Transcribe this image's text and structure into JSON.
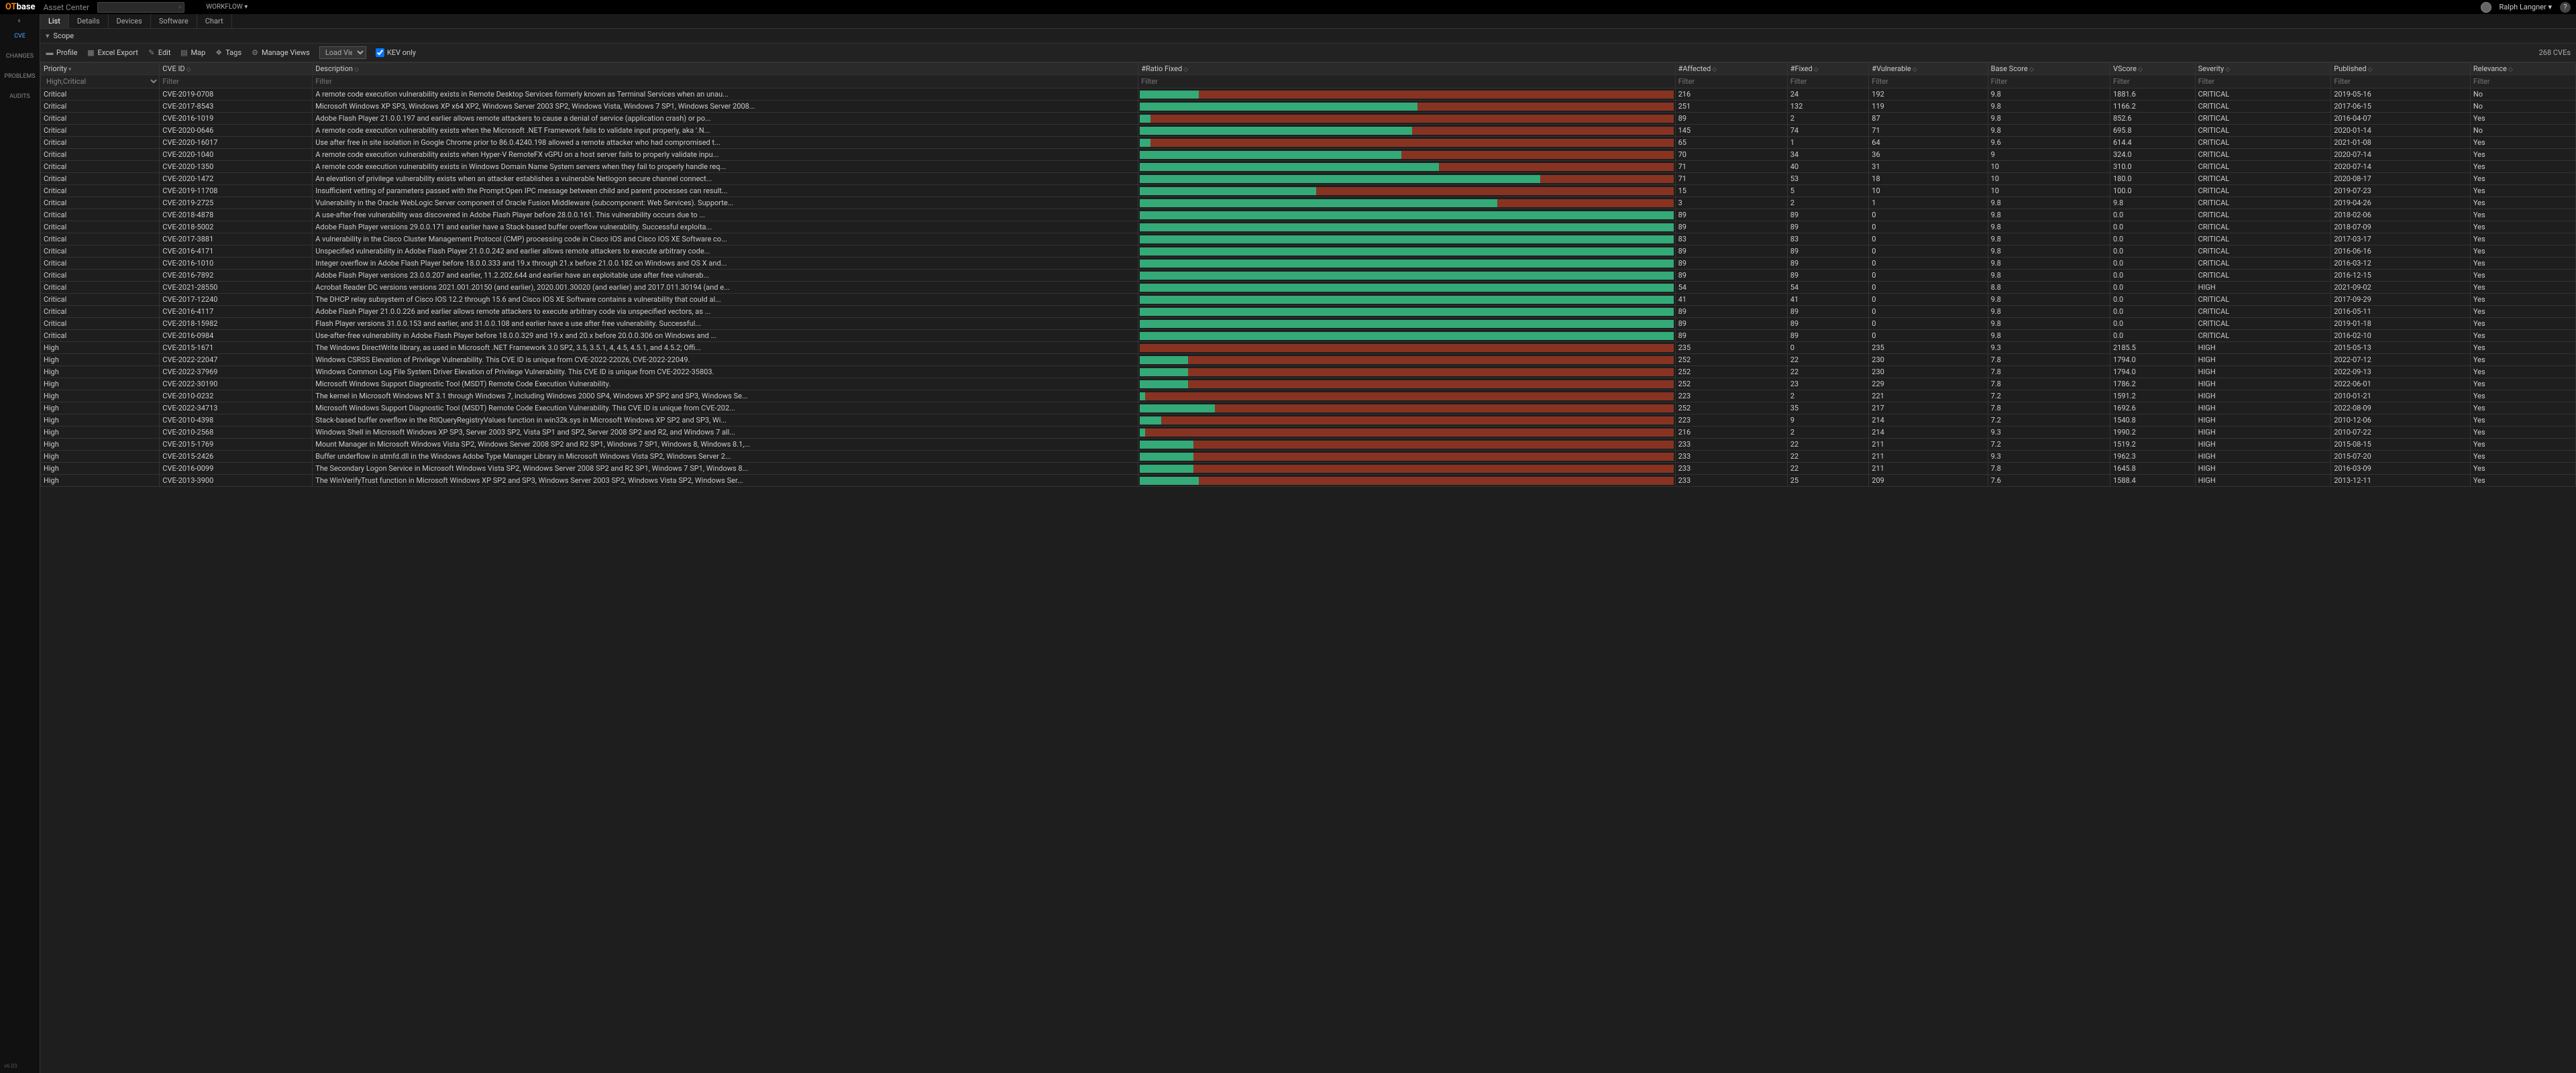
{
  "topbar": {
    "brand_ot": "OT",
    "brand_base": "base",
    "brand_sub": "Asset Center",
    "workflow": "WORKFLOW ▾",
    "username": "Ralph Langner ▾",
    "help": "?"
  },
  "leftnav": {
    "items": [
      "CVE",
      "CHANGES",
      "PROBLEMS",
      "AUDITS"
    ],
    "version": "v6.03"
  },
  "tabs": [
    "List",
    "Details",
    "Devices",
    "Software",
    "Chart"
  ],
  "scope_label": "Scope",
  "toolbar": {
    "profile": "Profile",
    "excel": "Excel Export",
    "edit": "Edit",
    "map": "Map",
    "tags": "Tags",
    "manage": "Manage Views",
    "load_view": "Load View ...",
    "kev": "KEV only",
    "count": "268 CVEs"
  },
  "columns": [
    "Priority",
    "CVE ID",
    "Description",
    "#Ratio Fixed",
    "#Affected",
    "#Fixed",
    "#Vulnerable",
    "Base Score",
    "VScore",
    "Severity",
    "Published",
    "Relevance"
  ],
  "filters": {
    "priority": "High,Critical",
    "placeholder": "Filter"
  },
  "rows": [
    {
      "pri": "Critical",
      "cve": "CVE-2019-0708",
      "desc": "A remote code execution vulnerability exists in Remote Desktop Services formerly known as Terminal Services when an unau...",
      "ratio": 11,
      "aff": "216",
      "fix": "24",
      "vul": "192",
      "base": "9.8",
      "vsc": "1881.6",
      "sev": "CRITICAL",
      "pub": "2019-05-16",
      "rel": "No"
    },
    {
      "pri": "Critical",
      "cve": "CVE-2017-8543",
      "desc": "Microsoft Windows XP SP3, Windows XP x64 XP2, Windows Server 2003 SP2, Windows Vista, Windows 7 SP1, Windows Server 2008...",
      "ratio": 52,
      "aff": "251",
      "fix": "132",
      "vul": "119",
      "base": "9.8",
      "vsc": "1166.2",
      "sev": "CRITICAL",
      "pub": "2017-06-15",
      "rel": "No"
    },
    {
      "pri": "Critical",
      "cve": "CVE-2016-1019",
      "desc": "Adobe Flash Player 21.0.0.197 and earlier allows remote attackers to cause a denial of service (application crash) or po...",
      "ratio": 2,
      "aff": "89",
      "fix": "2",
      "vul": "87",
      "base": "9.8",
      "vsc": "852.6",
      "sev": "CRITICAL",
      "pub": "2016-04-07",
      "rel": "Yes"
    },
    {
      "pri": "Critical",
      "cve": "CVE-2020-0646",
      "desc": "A remote code execution vulnerability exists when the Microsoft .NET Framework fails to validate input properly, aka '.N...",
      "ratio": 51,
      "aff": "145",
      "fix": "74",
      "vul": "71",
      "base": "9.8",
      "vsc": "695.8",
      "sev": "CRITICAL",
      "pub": "2020-01-14",
      "rel": "No"
    },
    {
      "pri": "Critical",
      "cve": "CVE-2020-16017",
      "desc": "Use after free in site isolation in Google Chrome prior to 86.0.4240.198 allowed a remote attacker who had compromised t...",
      "ratio": 2,
      "aff": "65",
      "fix": "1",
      "vul": "64",
      "base": "9.6",
      "vsc": "614.4",
      "sev": "CRITICAL",
      "pub": "2021-01-08",
      "rel": "Yes"
    },
    {
      "pri": "Critical",
      "cve": "CVE-2020-1040",
      "desc": "A remote code execution vulnerability exists when Hyper-V RemoteFX vGPU on a host server fails to properly validate inpu...",
      "ratio": 49,
      "aff": "70",
      "fix": "34",
      "vul": "36",
      "base": "9",
      "vsc": "324.0",
      "sev": "CRITICAL",
      "pub": "2020-07-14",
      "rel": "Yes"
    },
    {
      "pri": "Critical",
      "cve": "CVE-2020-1350",
      "desc": "A remote code execution vulnerability exists in Windows Domain Name System servers when they fail to properly handle req...",
      "ratio": 56,
      "aff": "71",
      "fix": "40",
      "vul": "31",
      "base": "10",
      "vsc": "310.0",
      "sev": "CRITICAL",
      "pub": "2020-07-14",
      "rel": "Yes"
    },
    {
      "pri": "Critical",
      "cve": "CVE-2020-1472",
      "desc": "An elevation of privilege vulnerability exists when an attacker establishes a vulnerable Netlogon secure channel connect...",
      "ratio": 75,
      "aff": "71",
      "fix": "53",
      "vul": "18",
      "base": "10",
      "vsc": "180.0",
      "sev": "CRITICAL",
      "pub": "2020-08-17",
      "rel": "Yes"
    },
    {
      "pri": "Critical",
      "cve": "CVE-2019-11708",
      "desc": "Insufficient vetting of parameters passed with the Prompt:Open IPC message between child and parent processes can result...",
      "ratio": 33,
      "aff": "15",
      "fix": "5",
      "vul": "10",
      "base": "10",
      "vsc": "100.0",
      "sev": "CRITICAL",
      "pub": "2019-07-23",
      "rel": "Yes"
    },
    {
      "pri": "Critical",
      "cve": "CVE-2019-2725",
      "desc": "Vulnerability in the Oracle WebLogic Server component of Oracle Fusion Middleware (subcomponent: Web Services). Supporte...",
      "ratio": 67,
      "aff": "3",
      "fix": "2",
      "vul": "1",
      "base": "9.8",
      "vsc": "9.8",
      "sev": "CRITICAL",
      "pub": "2019-04-26",
      "rel": "Yes"
    },
    {
      "pri": "Critical",
      "cve": "CVE-2018-4878",
      "desc": "A use-after-free vulnerability was discovered in Adobe Flash Player before 28.0.0.161. This vulnerability occurs due to ...",
      "ratio": 100,
      "aff": "89",
      "fix": "89",
      "vul": "0",
      "base": "9.8",
      "vsc": "0.0",
      "sev": "CRITICAL",
      "pub": "2018-02-06",
      "rel": "Yes"
    },
    {
      "pri": "Critical",
      "cve": "CVE-2018-5002",
      "desc": "Adobe Flash Player versions 29.0.0.171 and earlier have a Stack-based buffer overflow vulnerability. Successful exploita...",
      "ratio": 100,
      "aff": "89",
      "fix": "89",
      "vul": "0",
      "base": "9.8",
      "vsc": "0.0",
      "sev": "CRITICAL",
      "pub": "2018-07-09",
      "rel": "Yes"
    },
    {
      "pri": "Critical",
      "cve": "CVE-2017-3881",
      "desc": "A vulnerability in the Cisco Cluster Management Protocol (CMP) processing code in Cisco IOS and Cisco IOS XE Software co...",
      "ratio": 100,
      "aff": "83",
      "fix": "83",
      "vul": "0",
      "base": "9.8",
      "vsc": "0.0",
      "sev": "CRITICAL",
      "pub": "2017-03-17",
      "rel": "Yes"
    },
    {
      "pri": "Critical",
      "cve": "CVE-2016-4171",
      "desc": "Unspecified vulnerability in Adobe Flash Player 21.0.0.242 and earlier allows remote attackers to execute arbitrary code...",
      "ratio": 100,
      "aff": "89",
      "fix": "89",
      "vul": "0",
      "base": "9.8",
      "vsc": "0.0",
      "sev": "CRITICAL",
      "pub": "2016-06-16",
      "rel": "Yes"
    },
    {
      "pri": "Critical",
      "cve": "CVE-2016-1010",
      "desc": "Integer overflow in Adobe Flash Player before 18.0.0.333 and 19.x through 21.x before 21.0.0.182 on Windows and OS X and...",
      "ratio": 100,
      "aff": "89",
      "fix": "89",
      "vul": "0",
      "base": "9.8",
      "vsc": "0.0",
      "sev": "CRITICAL",
      "pub": "2016-03-12",
      "rel": "Yes"
    },
    {
      "pri": "Critical",
      "cve": "CVE-2016-7892",
      "desc": "Adobe Flash Player versions 23.0.0.207 and earlier, 11.2.202.644 and earlier have an exploitable use after free vulnerab...",
      "ratio": 100,
      "aff": "89",
      "fix": "89",
      "vul": "0",
      "base": "9.8",
      "vsc": "0.0",
      "sev": "CRITICAL",
      "pub": "2016-12-15",
      "rel": "Yes"
    },
    {
      "pri": "Critical",
      "cve": "CVE-2021-28550",
      "desc": "Acrobat Reader DC versions versions 2021.001.20150 (and earlier), 2020.001.30020 (and earlier) and 2017.011.30194 (and e...",
      "ratio": 100,
      "aff": "54",
      "fix": "54",
      "vul": "0",
      "base": "8.8",
      "vsc": "0.0",
      "sev": "HIGH",
      "pub": "2021-09-02",
      "rel": "Yes"
    },
    {
      "pri": "Critical",
      "cve": "CVE-2017-12240",
      "desc": "The DHCP relay subsystem of Cisco IOS 12.2 through 15.6 and Cisco IOS XE Software contains a vulnerability that could al...",
      "ratio": 100,
      "aff": "41",
      "fix": "41",
      "vul": "0",
      "base": "9.8",
      "vsc": "0.0",
      "sev": "CRITICAL",
      "pub": "2017-09-29",
      "rel": "Yes"
    },
    {
      "pri": "Critical",
      "cve": "CVE-2016-4117",
      "desc": "Adobe Flash Player 21.0.0.226 and earlier allows remote attackers to execute arbitrary code via unspecified vectors, as ...",
      "ratio": 100,
      "aff": "89",
      "fix": "89",
      "vul": "0",
      "base": "9.8",
      "vsc": "0.0",
      "sev": "CRITICAL",
      "pub": "2016-05-11",
      "rel": "Yes"
    },
    {
      "pri": "Critical",
      "cve": "CVE-2018-15982",
      "desc": "Flash Player versions 31.0.0.153 and earlier, and 31.0.0.108 and earlier have a use after free vulnerability. Successful...",
      "ratio": 100,
      "aff": "89",
      "fix": "89",
      "vul": "0",
      "base": "9.8",
      "vsc": "0.0",
      "sev": "CRITICAL",
      "pub": "2019-01-18",
      "rel": "Yes"
    },
    {
      "pri": "Critical",
      "cve": "CVE-2016-0984",
      "desc": "Use-after-free vulnerability in Adobe Flash Player before 18.0.0.329 and 19.x and 20.x before 20.0.0.306 on Windows and ...",
      "ratio": 100,
      "aff": "89",
      "fix": "89",
      "vul": "0",
      "base": "9.8",
      "vsc": "0.0",
      "sev": "CRITICAL",
      "pub": "2016-02-10",
      "rel": "Yes"
    },
    {
      "pri": "High",
      "cve": "CVE-2015-1671",
      "desc": "The Windows DirectWrite library, as used in Microsoft .NET Framework 3.0 SP2, 3.5, 3.5.1, 4, 4.5, 4.5.1, and 4.5.2; Offi...",
      "ratio": 0,
      "aff": "235",
      "fix": "0",
      "vul": "235",
      "base": "9.3",
      "vsc": "2185.5",
      "sev": "HIGH",
      "pub": "2015-05-13",
      "rel": "Yes"
    },
    {
      "pri": "High",
      "cve": "CVE-2022-22047",
      "desc": "Windows CSRSS Elevation of Privilege Vulnerability. This CVE ID is unique from CVE-2022-22026, CVE-2022-22049.",
      "ratio": 9,
      "aff": "252",
      "fix": "22",
      "vul": "230",
      "base": "7.8",
      "vsc": "1794.0",
      "sev": "HIGH",
      "pub": "2022-07-12",
      "rel": "Yes"
    },
    {
      "pri": "High",
      "cve": "CVE-2022-37969",
      "desc": "Windows Common Log File System Driver Elevation of Privilege Vulnerability. This CVE ID is unique from CVE-2022-35803.",
      "ratio": 9,
      "aff": "252",
      "fix": "22",
      "vul": "230",
      "base": "7.8",
      "vsc": "1794.0",
      "sev": "HIGH",
      "pub": "2022-09-13",
      "rel": "Yes"
    },
    {
      "pri": "High",
      "cve": "CVE-2022-30190",
      "desc": "Microsoft Windows Support Diagnostic Tool (MSDT) Remote Code Execution Vulnerability.",
      "ratio": 9,
      "aff": "252",
      "fix": "23",
      "vul": "229",
      "base": "7.8",
      "vsc": "1786.2",
      "sev": "HIGH",
      "pub": "2022-06-01",
      "rel": "Yes"
    },
    {
      "pri": "High",
      "cve": "CVE-2010-0232",
      "desc": "The kernel in Microsoft Windows NT 3.1 through Windows 7, including Windows 2000 SP4, Windows XP SP2 and SP3, Windows Se...",
      "ratio": 1,
      "aff": "223",
      "fix": "2",
      "vul": "221",
      "base": "7.2",
      "vsc": "1591.2",
      "sev": "HIGH",
      "pub": "2010-01-21",
      "rel": "Yes"
    },
    {
      "pri": "High",
      "cve": "CVE-2022-34713",
      "desc": "Microsoft Windows Support Diagnostic Tool (MSDT) Remote Code Execution Vulnerability. This CVE ID is unique from CVE-202...",
      "ratio": 14,
      "aff": "252",
      "fix": "35",
      "vul": "217",
      "base": "7.8",
      "vsc": "1692.6",
      "sev": "HIGH",
      "pub": "2022-08-09",
      "rel": "Yes"
    },
    {
      "pri": "High",
      "cve": "CVE-2010-4398",
      "desc": "Stack-based buffer overflow in the RtlQueryRegistryValues function in win32k.sys in Microsoft Windows XP SP2 and SP3, Wi...",
      "ratio": 4,
      "aff": "223",
      "fix": "9",
      "vul": "214",
      "base": "7.2",
      "vsc": "1540.8",
      "sev": "HIGH",
      "pub": "2010-12-06",
      "rel": "Yes"
    },
    {
      "pri": "High",
      "cve": "CVE-2010-2568",
      "desc": "Windows Shell in Microsoft Windows XP SP3, Server 2003 SP2, Vista SP1 and SP2, Server 2008 SP2 and R2, and Windows 7 all...",
      "ratio": 1,
      "aff": "216",
      "fix": "2",
      "vul": "214",
      "base": "9.3",
      "vsc": "1990.2",
      "sev": "HIGH",
      "pub": "2010-07-22",
      "rel": "Yes"
    },
    {
      "pri": "High",
      "cve": "CVE-2015-1769",
      "desc": "Mount Manager in Microsoft Windows Vista SP2, Windows Server 2008 SP2 and R2 SP1, Windows 7 SP1, Windows 8, Windows 8.1,...",
      "ratio": 10,
      "aff": "233",
      "fix": "22",
      "vul": "211",
      "base": "7.2",
      "vsc": "1519.2",
      "sev": "HIGH",
      "pub": "2015-08-15",
      "rel": "Yes"
    },
    {
      "pri": "High",
      "cve": "CVE-2015-2426",
      "desc": "Buffer underflow in atmfd.dll in the Windows Adobe Type Manager Library in Microsoft Windows Vista SP2, Windows Server 2...",
      "ratio": 10,
      "aff": "233",
      "fix": "22",
      "vul": "211",
      "base": "9.3",
      "vsc": "1962.3",
      "sev": "HIGH",
      "pub": "2015-07-20",
      "rel": "Yes"
    },
    {
      "pri": "High",
      "cve": "CVE-2016-0099",
      "desc": "The Secondary Logon Service in Microsoft Windows Vista SP2, Windows Server 2008 SP2 and R2 SP1, Windows 7 SP1, Windows 8...",
      "ratio": 10,
      "aff": "233",
      "fix": "22",
      "vul": "211",
      "base": "7.8",
      "vsc": "1645.8",
      "sev": "HIGH",
      "pub": "2016-03-09",
      "rel": "Yes"
    },
    {
      "pri": "High",
      "cve": "CVE-2013-3900",
      "desc": "The WinVerifyTrust function in Microsoft Windows XP SP2 and SP3, Windows Server 2003 SP2, Windows Vista SP2, Windows Ser...",
      "ratio": 11,
      "aff": "233",
      "fix": "25",
      "vul": "209",
      "base": "7.6",
      "vsc": "1588.4",
      "sev": "HIGH",
      "pub": "2013-12-11",
      "rel": "Yes"
    }
  ]
}
